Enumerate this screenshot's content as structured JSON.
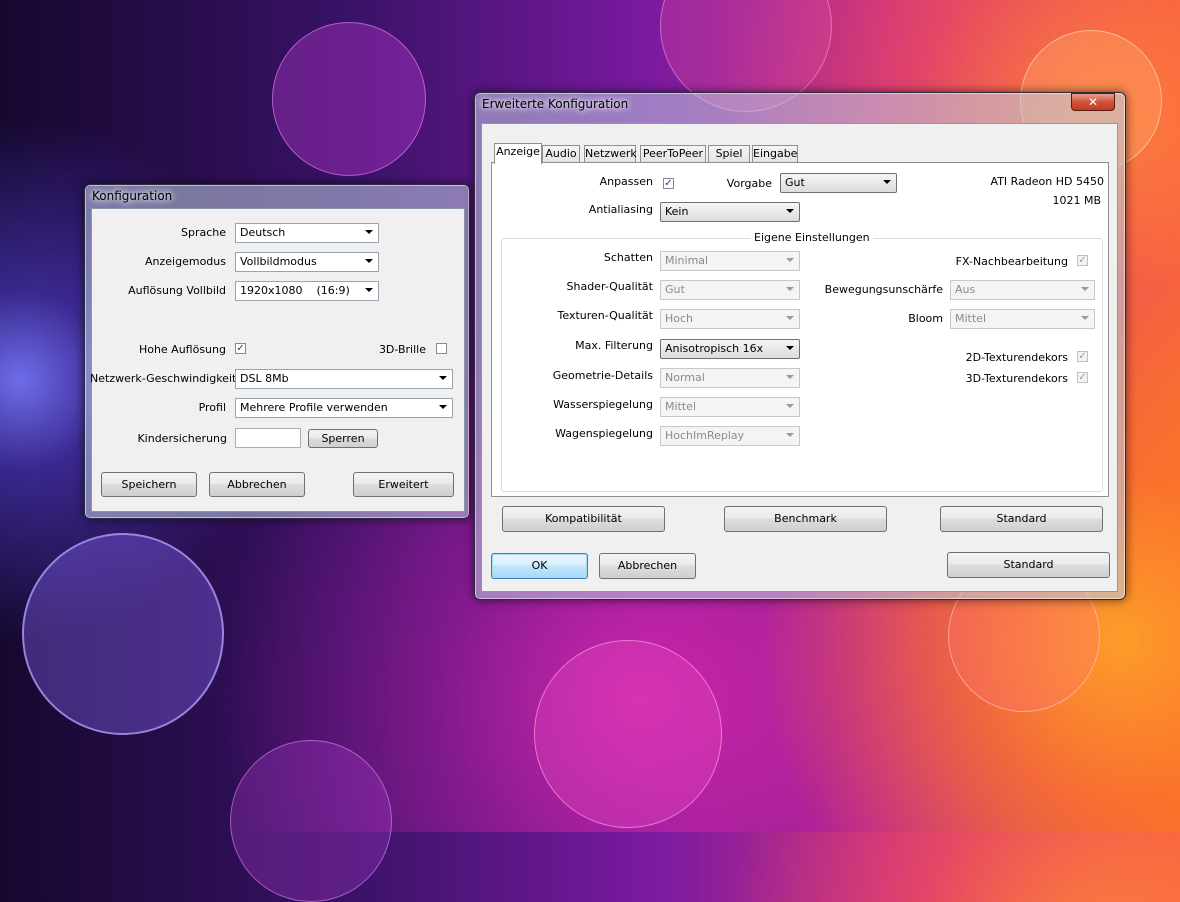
{
  "colors": {
    "accent": "#3c7fb1",
    "close_button": "#c23a20"
  },
  "dialog_main": {
    "title": "Konfiguration",
    "sprache_label": "Sprache",
    "sprache_value": "Deutsch",
    "anzeigemodus_label": "Anzeigemodus",
    "anzeigemodus_value": "Vollbildmodus",
    "aufloesung_label": "Auflösung Vollbild",
    "aufloesung_value": "1920x1080    (16:9)",
    "hohe_aufloesung_label": "Hohe Auflösung",
    "hohe_aufloesung_checked": true,
    "brille_label": "3D-Brille",
    "brille_checked": false,
    "netzwerk_label": "Netzwerk-Geschwindigkeit",
    "netzwerk_value": "DSL 8Mb",
    "profil_label": "Profil",
    "profil_value": "Mehrere Profile verwenden",
    "kindersicherung_label": "Kindersicherung",
    "kindersicherung_value": "",
    "sperren_button": "Sperren",
    "speichern_button": "Speichern",
    "abbrechen_button": "Abbrechen",
    "erweitert_button": "Erweitert"
  },
  "dialog_advanced": {
    "title": "Erweiterte Konfiguration",
    "close_glyph": "✕",
    "tabs": [
      "Anzeige",
      "Audio",
      "Netzwerk",
      "PeerToPeer",
      "Spiel",
      "Eingabe"
    ],
    "active_tab": "Anzeige",
    "anpassen_label": "Anpassen",
    "anpassen_checked": true,
    "vorgabe_label": "Vorgabe",
    "vorgabe_value": "Gut",
    "antialiasing_label": "Antialiasing",
    "antialiasing_value": "Kein",
    "gpu_name": "ATI Radeon HD 5450",
    "gpu_memory": "1021 MB",
    "group_title": "Eigene Einstellungen",
    "schatten_label": "Schatten",
    "schatten_value": "Minimal",
    "shader_label": "Shader-Qualität",
    "shader_value": "Gut",
    "texturen_label": "Texturen-Qualität",
    "texturen_value": "Hoch",
    "filterung_label": "Max. Filterung",
    "filterung_value": "Anisotropisch 16x",
    "geometrie_label": "Geometrie-Details",
    "geometrie_value": "Normal",
    "wasser_label": "Wasserspiegelung",
    "wasser_value": "Mittel",
    "wagen_label": "Wagenspiegelung",
    "wagen_value": "HochImReplay",
    "fx_label": "FX-Nachbearbeitung",
    "fx_checked": true,
    "bewegung_label": "Bewegungsunschärfe",
    "bewegung_value": "Aus",
    "bloom_label": "Bloom",
    "bloom_value": "Mittel",
    "texturendekors2d_label": "2D-Texturendekors",
    "texturendekors2d_checked": true,
    "texturendekors3d_label": "3D-Texturendekors",
    "texturendekors3d_checked": true,
    "kompatibilitaet_button": "Kompatibilität",
    "benchmark_button": "Benchmark",
    "standard_inner_button": "Standard",
    "ok_button": "OK",
    "abbrechen_button": "Abbrechen",
    "standard_button": "Standard",
    "check_glyph": "✓"
  }
}
